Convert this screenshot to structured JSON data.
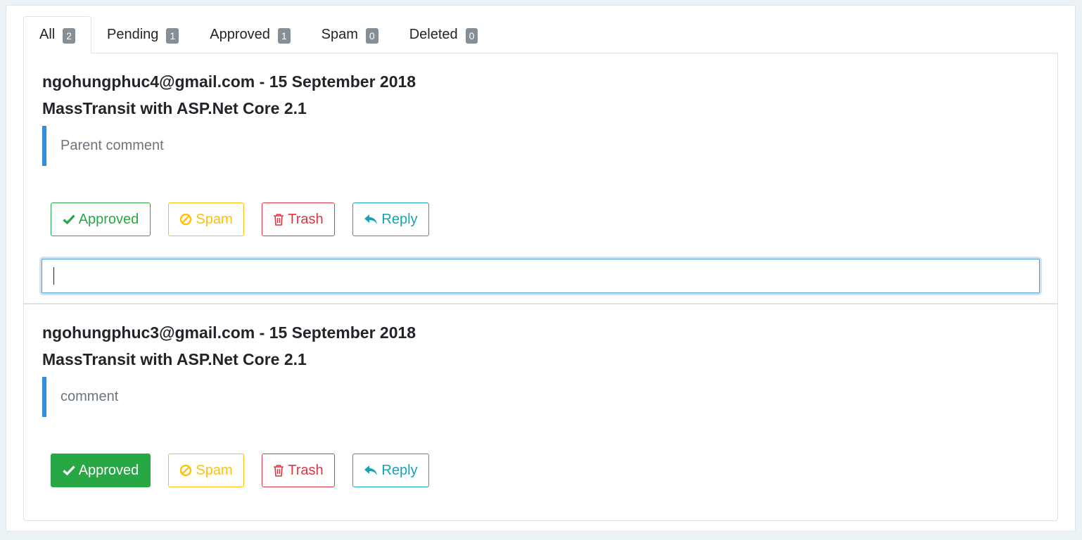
{
  "tabs": [
    {
      "label": "All",
      "count": "2",
      "active": true
    },
    {
      "label": "Pending",
      "count": "1"
    },
    {
      "label": "Approved",
      "count": "1"
    },
    {
      "label": "Spam",
      "count": "0"
    },
    {
      "label": "Deleted",
      "count": "0"
    }
  ],
  "comments": [
    {
      "meta": "ngohungphuc4@gmail.com - 15 September 2018",
      "post_title": "MassTransit with ASP.Net Core 2.1",
      "body": "Parent comment",
      "actions": {
        "approve": "Approved",
        "spam": "Spam",
        "trash": "Trash",
        "reply": "Reply"
      },
      "approved_state": "outline",
      "reply_input_value": ""
    },
    {
      "meta": "ngohungphuc3@gmail.com - 15 September 2018",
      "post_title": "MassTransit with ASP.Net Core 2.1",
      "body": "comment",
      "actions": {
        "approve": "Approved",
        "spam": "Spam",
        "trash": "Trash",
        "reply": "Reply"
      },
      "approved_state": "filled"
    }
  ],
  "icons": {
    "approve": "check-icon",
    "spam": "ban-icon",
    "trash": "trash-icon",
    "reply": "reply-icon"
  },
  "colors": {
    "success": "#28a745",
    "warning": "#ffc107",
    "danger": "#dc3545",
    "info": "#17a2b8",
    "quote_border": "#2f8fde",
    "badge": "#868e96"
  }
}
